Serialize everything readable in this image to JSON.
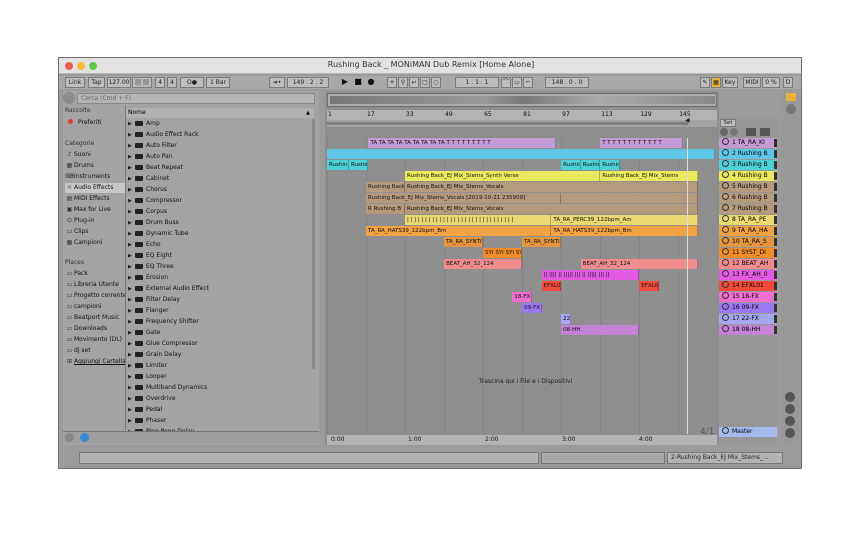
{
  "window": {
    "title": "Rushing Back _ MONiMAN Dub Remix  [Home Alone]"
  },
  "control_bar": {
    "link": "Link",
    "tap": "Tap",
    "tempo": "127.00",
    "tempo_icon": "||| |||",
    "sig_num": "4",
    "sig_den": "4",
    "metro": "O●",
    "quant": "1 Bar",
    "follow": "➜•",
    "position": "149 .  2 .  2",
    "loop_start": "1 .  1 .  1",
    "loop_len": "148 .  0 .  0",
    "key": "Key",
    "midi": "MIDI",
    "cpu": "0 %",
    "disk": "D"
  },
  "browser": {
    "search_placeholder": "Cerca (Cmd + F)",
    "col_header": "Nome",
    "sections": {
      "raccolte": "Raccolte",
      "categorie": "Categorie",
      "places": "Places"
    },
    "collections": [
      "Preferiti"
    ],
    "categories": [
      "Suoni",
      "Drums",
      "Instruments",
      "Audio Effects",
      "MIDI Effects",
      "Max for Live",
      "Plug-in",
      "Clips",
      "Campioni"
    ],
    "places": [
      "Pack",
      "Libreria Utente",
      "Progetto corrente",
      "campioni",
      "Beatport Music",
      "Downloads",
      "Movimento (DL)",
      "dj set",
      "Aggiungi Cartella..."
    ],
    "items": [
      "Amp",
      "Audio Effect Rack",
      "Auto Filter",
      "Auto Pan",
      "Beat Repeat",
      "Cabinet",
      "Chorus",
      "Compressor",
      "Corpus",
      "Drum Buss",
      "Dynamic Tube",
      "Echo",
      "EQ Eight",
      "EQ Three",
      "Erosion",
      "External Audio Effect",
      "Filter Delay",
      "Flanger",
      "Frequency Shifter",
      "Gate",
      "Glue Compressor",
      "Grain Delay",
      "Limiter",
      "Looper",
      "Multiband Dynamics",
      "Overdrive",
      "Pedal",
      "Phaser",
      "Ping Pong Delay"
    ]
  },
  "ruler": [
    "1",
    "17",
    "33",
    "49",
    "65",
    "81",
    "97",
    "113",
    "129",
    "145"
  ],
  "time_ruler": [
    "0:00",
    "1:00",
    "2:00",
    "3:00",
    "4:00"
  ],
  "set_label": "Set",
  "drop_hint": "Trascina qui i File e i Dispositivi",
  "bar_counter": "4/1",
  "tracks": [
    {
      "name": "1 TA_RA_KI",
      "color": "#c39bd6"
    },
    {
      "name": "2 Rushing B",
      "color": "#5fc7e6"
    },
    {
      "name": "3 Rushing B",
      "color": "#4fd0d6"
    },
    {
      "name": "4 Rushing B",
      "color": "#eaea5e"
    },
    {
      "name": "5 Rushing B",
      "color": "#b59a7c"
    },
    {
      "name": "6 Rushing B",
      "color": "#b59a7c"
    },
    {
      "name": "7 Rushing B",
      "color": "#b59a7c"
    },
    {
      "name": "8 TA_RA_PE",
      "color": "#ecd871"
    },
    {
      "name": "9 TA_RA_HA",
      "color": "#f0a245"
    },
    {
      "name": "10 TA_RA_S",
      "color": "#e39640"
    },
    {
      "name": "11 SYST_DI",
      "color": "#f08c2a"
    },
    {
      "name": "12 BEAT_AH",
      "color": "#f08c90"
    },
    {
      "name": "13 FX_AH_0",
      "color": "#e35ae3"
    },
    {
      "name": "14 EFXL01",
      "color": "#f24a3d"
    },
    {
      "name": "15 18-FX",
      "color": "#ee6fd0"
    },
    {
      "name": "16 09-FX",
      "color": "#9c78f2"
    },
    {
      "name": "17 22-FX",
      "color": "#a5a7ef"
    },
    {
      "name": "18 08-HH",
      "color": "#c583d6"
    }
  ],
  "master": {
    "name": "Master",
    "color": "#a5b8f0"
  },
  "clips": [
    {
      "row": 0,
      "start": 18,
      "end": 95,
      "label": "TA TA TA TA TA TA TA TA TA T T T T T T T T T",
      "color": "#c39bd6"
    },
    {
      "row": 0,
      "start": 113,
      "end": 147,
      "label": "T T T T T T T T T T T T",
      "color": "#c39bd6"
    },
    {
      "row": 1,
      "start": 1,
      "end": 160,
      "label": "",
      "color": "#5fc7e6"
    },
    {
      "row": 2,
      "start": 1,
      "end": 10,
      "label": "Rushin",
      "color": "#4fd0d6"
    },
    {
      "row": 2,
      "start": 10,
      "end": 18,
      "label": "Rushin",
      "color": "#4fd0d6"
    },
    {
      "row": 2,
      "start": 97,
      "end": 105,
      "label": "Rushin",
      "color": "#4fd0d6"
    },
    {
      "row": 2,
      "start": 105,
      "end": 113,
      "label": "Rushin",
      "color": "#4fd0d6"
    },
    {
      "row": 2,
      "start": 113,
      "end": 121,
      "label": "Rushin",
      "color": "#4fd0d6"
    },
    {
      "row": 3,
      "start": 33,
      "end": 113,
      "label": "Rushing Back_EJ Mix_Stems_Synth Verse",
      "color": "#eaea5e"
    },
    {
      "row": 3,
      "start": 113,
      "end": 153,
      "label": "Rushing Back_EJ Mix_Stems",
      "color": "#eaea5e"
    },
    {
      "row": 4,
      "start": 17,
      "end": 33,
      "label": "Rushing Back",
      "color": "#b59a7c"
    },
    {
      "row": 4,
      "start": 33,
      "end": 153,
      "label": "Rushing Back_EJ Mix_Stems_Vocals",
      "color": "#b59a7c"
    },
    {
      "row": 5,
      "start": 17,
      "end": 97,
      "label": "Rushing Back_EJ Mix_Stems_Vocals [2019-10-21 235909]",
      "color": "#b59a7c"
    },
    {
      "row": 5,
      "start": 97,
      "end": 153,
      "label": "",
      "color": "#b59a7c"
    },
    {
      "row": 6,
      "start": 17,
      "end": 33,
      "label": "R Rushing B",
      "color": "#b59a7c"
    },
    {
      "row": 6,
      "start": 33,
      "end": 153,
      "label": "Rushing Back_EJ Mix_Stems_Vocals",
      "color": "#b59a7c"
    },
    {
      "row": 7,
      "start": 33,
      "end": 93,
      "label": "| | | | | | | | | | | | | | | | | | | | | | | | | | | | | |",
      "color": "#ecd871"
    },
    {
      "row": 7,
      "start": 93,
      "end": 153,
      "label": "TA_RA_PERC39_122bpm_Am",
      "color": "#ecd871"
    },
    {
      "row": 8,
      "start": 17,
      "end": 93,
      "label": "TA_RA_HATS39_122bpm_Bm",
      "color": "#f0a245"
    },
    {
      "row": 8,
      "start": 93,
      "end": 153,
      "label": "TA_RA_HATS39_122bpm_Bm",
      "color": "#f0a245"
    },
    {
      "row": 9,
      "start": 49,
      "end": 65,
      "label": "TA_RA_SYNTI",
      "color": "#e39640"
    },
    {
      "row": 9,
      "start": 81,
      "end": 97,
      "label": "TA_RA_SYNTI",
      "color": "#e39640"
    },
    {
      "row": 10,
      "start": 65,
      "end": 81,
      "label": "SYI SYI SYI SYI",
      "color": "#f08c2a"
    },
    {
      "row": 11,
      "start": 49,
      "end": 81,
      "label": "BEAT_AH_32_124",
      "color": "#f08c90"
    },
    {
      "row": 11,
      "start": 105,
      "end": 153,
      "label": "BEAT_AH_32_124",
      "color": "#f08c90"
    },
    {
      "row": 12,
      "start": 89,
      "end": 129,
      "label": "|| |||| || ||||| ||| || ||||| ||| ||",
      "color": "#e35ae3"
    },
    {
      "row": 13,
      "start": 89,
      "end": 97,
      "label": "EFXL0",
      "color": "#f24a3d"
    },
    {
      "row": 13,
      "start": 129,
      "end": 137,
      "label": "EFXL0",
      "color": "#f24a3d"
    },
    {
      "row": 14,
      "start": 77,
      "end": 85,
      "label": "18-FX",
      "color": "#ee6fd0"
    },
    {
      "row": 15,
      "start": 81,
      "end": 89,
      "label": "09-FX",
      "color": "#9c78f2"
    },
    {
      "row": 16,
      "start": 97,
      "end": 101,
      "label": "22-",
      "color": "#a5a7ef"
    },
    {
      "row": 17,
      "start": 97,
      "end": 129,
      "label": "08-HH",
      "color": "#c583d6"
    }
  ],
  "status": {
    "right": "2-Rushing Back_EJ Mix_Stems_..."
  }
}
